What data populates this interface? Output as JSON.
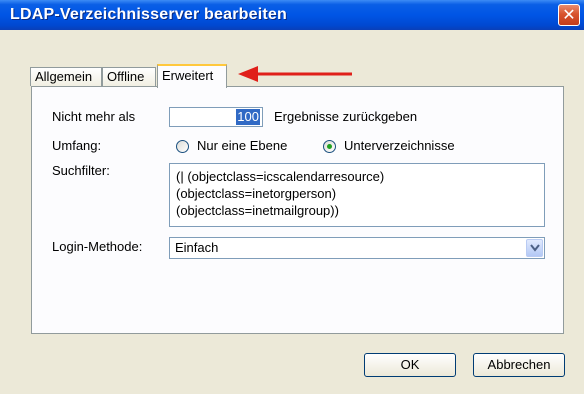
{
  "window": {
    "title": "LDAP-Verzeichnisserver bearbeiten",
    "close_glyph": "✕"
  },
  "tabs": [
    {
      "label": "Allgemein",
      "active": false
    },
    {
      "label": "Offline",
      "active": false
    },
    {
      "label": "Erweitert",
      "active": true
    }
  ],
  "form": {
    "max_results_label": "Nicht mehr als",
    "max_results_value": "100",
    "max_results_suffix": "Ergebnisse zurückgeben",
    "scope_label": "Umfang:",
    "scope_options": [
      {
        "label": "Nur eine Ebene",
        "selected": false
      },
      {
        "label": "Unterverzeichnisse",
        "selected": true
      }
    ],
    "filter_label": "Suchfilter:",
    "filter_lines": [
      "(| (objectclass=icscalendarresource)",
      "(objectclass=inetorgperson)",
      "(objectclass=inetmailgroup))"
    ],
    "login_label": "Login-Methode:",
    "login_value": "Einfach"
  },
  "buttons": {
    "ok": "OK",
    "cancel": "Abbrechen"
  },
  "colors": {
    "titlebar": "#0055e5",
    "annotation_arrow": "#e0201a",
    "tab_highlight": "#ffc83c"
  }
}
